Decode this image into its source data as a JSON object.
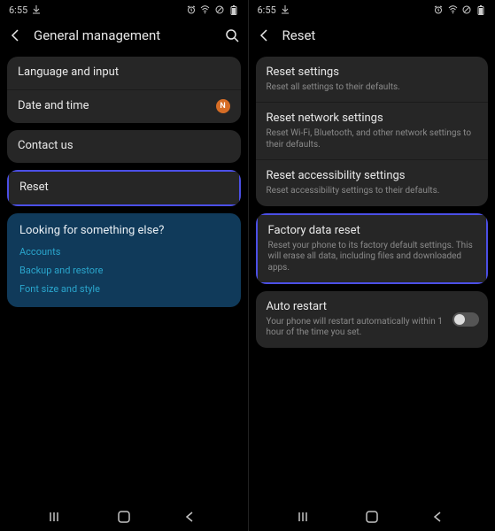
{
  "left": {
    "status": {
      "time": "6:55",
      "icons": [
        "download",
        "alarm",
        "wifi",
        "no-signal",
        "battery"
      ]
    },
    "header": {
      "title": "General management",
      "search": true
    },
    "sections": [
      {
        "items": [
          {
            "title": "Language and input"
          },
          {
            "title": "Date and time",
            "badge": "N"
          }
        ]
      },
      {
        "items": [
          {
            "title": "Contact us"
          }
        ]
      },
      {
        "items": [
          {
            "title": "Reset",
            "highlighted": true
          }
        ]
      }
    ],
    "footer": {
      "title": "Looking for something else?",
      "links": [
        "Accounts",
        "Backup and restore",
        "Font size and style"
      ]
    }
  },
  "right": {
    "status": {
      "time": "6:55",
      "icons": [
        "download",
        "alarm",
        "wifi",
        "no-signal",
        "battery"
      ]
    },
    "header": {
      "title": "Reset",
      "search": false
    },
    "sections": [
      {
        "items": [
          {
            "title": "Reset settings",
            "sub": "Reset all settings to their defaults."
          },
          {
            "title": "Reset network settings",
            "sub": "Reset Wi-Fi, Bluetooth, and other network settings to their defaults."
          },
          {
            "title": "Reset accessibility settings",
            "sub": "Reset accessibility settings to their defaults."
          }
        ]
      },
      {
        "items": [
          {
            "title": "Factory data reset",
            "sub": "Reset your phone to its factory default settings. This will erase all data, including files and downloaded apps.",
            "highlighted": true
          }
        ]
      },
      {
        "items": [
          {
            "title": "Auto restart",
            "sub": "Your phone will restart automatically within 1 hour of the time you set.",
            "toggle": false
          }
        ]
      }
    ]
  },
  "nav": [
    "recents",
    "home",
    "back"
  ]
}
